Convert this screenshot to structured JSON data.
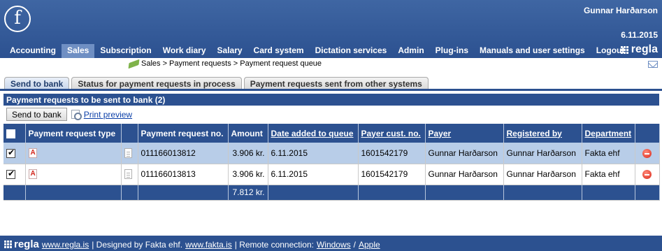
{
  "header": {
    "user_name": "Gunnar Harðarson",
    "date": "6.11.2015",
    "brand": "regla",
    "nav": [
      {
        "label": "Accounting"
      },
      {
        "label": "Sales"
      },
      {
        "label": "Subscription"
      },
      {
        "label": "Work diary"
      },
      {
        "label": "Salary"
      },
      {
        "label": "Card system"
      },
      {
        "label": "Dictation services"
      },
      {
        "label": "Admin"
      },
      {
        "label": "Plug-ins"
      },
      {
        "label": "Manuals and user settings"
      },
      {
        "label": "Logout"
      }
    ],
    "active_nav": "Sales"
  },
  "breadcrumb": "Sales > Payment requests > Payment request queue",
  "tabs": [
    {
      "label": "Send to bank"
    },
    {
      "label": "Status for payment requests in process"
    },
    {
      "label": "Payment requests sent from other systems"
    }
  ],
  "active_tab": "Send to bank",
  "section_title": "Payment requests to be sent to bank  (2)",
  "toolbar": {
    "send_label": "Send to bank",
    "print_label": "Print preview"
  },
  "table": {
    "columns": [
      "Payment request type",
      "Payment request no.",
      "Amount",
      "Date added to queue",
      "Payer cust. no.",
      "Payer",
      "Registered by",
      "Department"
    ],
    "rows": [
      {
        "checked": true,
        "request_no": "011166013812",
        "amount": "3.906 kr.",
        "date_added": "6.11.2015",
        "payer_cust_no": "1601542179",
        "payer": "Gunnar Harðarson",
        "registered_by": "Gunnar Harðarson",
        "department": "Fakta ehf"
      },
      {
        "checked": true,
        "request_no": "011166013813",
        "amount": "3.906 kr.",
        "date_added": "6.11.2015",
        "payer_cust_no": "1601542179",
        "payer": "Gunnar Harðarson",
        "registered_by": "Gunnar Harðarson",
        "department": "Fakta ehf"
      }
    ],
    "total_amount": "7.812 kr."
  },
  "footer": {
    "brand": "regla",
    "site_link": "www.regla.is",
    "designed_by": "| Designed by Fakta ehf.",
    "fakta_link": "www.fakta.is",
    "remote_text": "| Remote connection:",
    "windows_link": "Windows",
    "separator": "/",
    "apple_link": "Apple"
  },
  "colors": {
    "header_blue": "#2c5190",
    "active_nav": "#6f8fc3",
    "selected_row": "#b8cde8"
  }
}
